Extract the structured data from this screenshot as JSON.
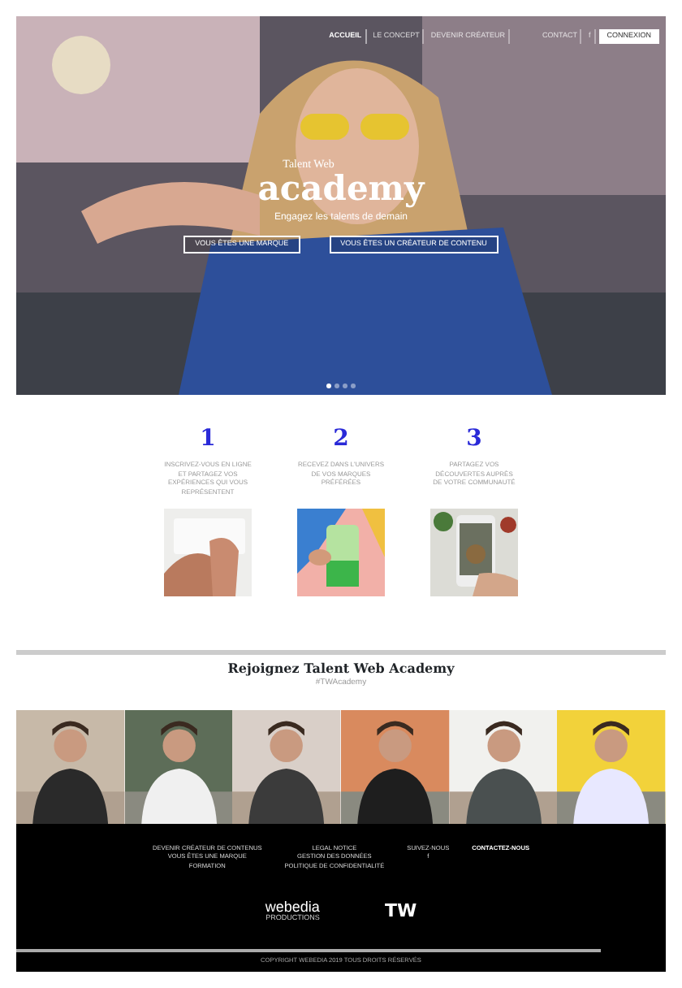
{
  "navbar": {
    "links": [
      {
        "label": "ACCUEIL",
        "selected": true
      },
      {
        "label": "LE CONCEPT",
        "selected": false
      },
      {
        "label": "DEVENIR CRÉATEUR",
        "selected": false
      }
    ],
    "contact": "CONTACT",
    "social": "f",
    "login": "CONNEXION"
  },
  "hero": {
    "kicker": "Talent Web",
    "title": "academy",
    "subtitle": "Engagez les talents de demain",
    "buttons": [
      "VOUS ÊTES UNE MARQUE",
      "VOUS ÊTES UN CRÉATEUR DE CONTENU"
    ],
    "slides": [
      {
        "selected": true
      },
      {
        "selected": false
      },
      {
        "selected": false
      },
      {
        "selected": false
      }
    ]
  },
  "steps": [
    {
      "number": "1",
      "text": "INSCRIVEZ-VOUS EN LIGNE ET PARTAGEZ VOS EXPÉRIENCES QUI VOUS REPRÉSENTENT"
    },
    {
      "number": "2",
      "text": "RECEVEZ DANS L'UNIVERS DE VOS MARQUES PRÉFÉRÉES"
    },
    {
      "number": "3",
      "text": "PARTAGEZ VOS DÉCOUVERTES AUPRÈS DE VOTRE COMMUNAUTÉ"
    }
  ],
  "join": {
    "title": "Rejoignez Talent Web Academy",
    "hashtag": "#TWAcademy"
  },
  "footer": {
    "columns": [
      [
        "DEVENIR CRÉATEUR DE CONTENUS",
        "VOUS ÊTES UNE MARQUE",
        "FORMATION"
      ],
      [
        "LEGAL NOTICE",
        "GESTION DES DONNÉES",
        "POLITIQUE DE CONFIDENTIALITÉ"
      ],
      [
        "SUIVEZ-NOUS",
        "f"
      ],
      [
        "CONTACTEZ-NOUS"
      ]
    ],
    "logos": [
      "webedia",
      "TW"
    ],
    "logo_sub": "PRODUCTIONS",
    "copyright": "COPYRIGHT WEBEDIA 2019 TOUS DROITS RÉSERVÉS"
  }
}
